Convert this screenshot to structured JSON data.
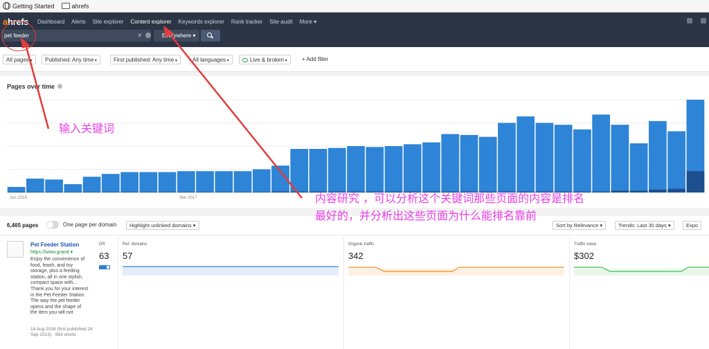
{
  "bookmarks": [
    {
      "label": "Getting Started",
      "icon": "globe-icon"
    },
    {
      "label": "ahrefs",
      "icon": "folder-icon"
    }
  ],
  "nav": {
    "logo_a": "a",
    "logo_rest": "hrefs",
    "items": [
      "Dashboard",
      "Alerts",
      "Site explorer",
      "Content explorer",
      "Keywords explorer",
      "Rank tracker",
      "Site audit",
      "More ▾"
    ],
    "active": "Content explorer"
  },
  "search": {
    "value": "pet feeder",
    "clear": "✕",
    "scope": "Everywhere ▾"
  },
  "filters": {
    "all_pages": "All pages",
    "published": "Published: Any time",
    "first_published": "First published: Any time",
    "languages": "All languages",
    "live": "Live & broken",
    "add": "+ Add filter"
  },
  "chart_panel": {
    "title": "Pages over time"
  },
  "chart_data": {
    "type": "bar",
    "title": "Pages over time",
    "x_tick_labels": [
      "Jun 2016",
      "Mar 2017"
    ],
    "ylim": [
      0,
      100
    ],
    "grid": true,
    "colors": {
      "light": "#2e84d6",
      "dark": "#1d4f8e"
    },
    "series": [
      {
        "values": [
          6,
          15,
          14,
          9,
          17,
          20,
          22,
          22,
          22,
          23,
          23,
          23,
          23,
          25,
          29,
          47,
          47,
          48,
          50,
          49,
          50,
          52,
          54,
          63,
          62,
          60,
          75,
          82,
          75,
          73,
          68,
          84,
          73,
          53,
          77,
          66,
          100
        ]
      },
      {
        "values": [
          0.5,
          0.5,
          0.5,
          0.5,
          0.5,
          0.5,
          0.5,
          0.5,
          0.5,
          0.5,
          0.5,
          0.5,
          0.5,
          0.5,
          1,
          1,
          1,
          1,
          1,
          1,
          1,
          1,
          1,
          1,
          1,
          1,
          1,
          1,
          1,
          1,
          1,
          1,
          2,
          2,
          3,
          4,
          23
        ]
      }
    ]
  },
  "results": {
    "count": "6,465 pages",
    "one_page": "One page per domain",
    "highlight": "Highlight unlinked domains ▾",
    "sort": "Sort by Relevance ▾",
    "trends": "Trends: Last 30 days ▾",
    "export": "Expo"
  },
  "result": {
    "title": "Pet Feeder Station",
    "url": "https://www.grand ▾",
    "snippet": "Enjoy the convenience of food, leash, and toy storage, plus a feeding station, all in one stylish, compact space with... Thank you for your interest in the Pet Feeder Station. The way the pet feeder opens and the shape of the item you will not",
    "meta": "14 Aug 2018 (first published 24 Sep 2013) · 963 words",
    "dr_label": "DR",
    "dr_value": "63",
    "dr_fraction": 0.63,
    "metrics": [
      {
        "label": "Ref. domains",
        "value": "57",
        "color": "#2d7fd8"
      },
      {
        "label": "Organic traffic",
        "value": "342",
        "color": "#f08a1c"
      },
      {
        "label": "Traffic value",
        "value": "$302",
        "color": "#3bbf4a"
      }
    ]
  },
  "annotations": {
    "keyword": "输入关键词",
    "research_line1": "内容研究 ，可以分析这个关键词那些页面的内容是排名",
    "research_line2": "最好的，并分析出这些页面为什么能排名靠前"
  }
}
